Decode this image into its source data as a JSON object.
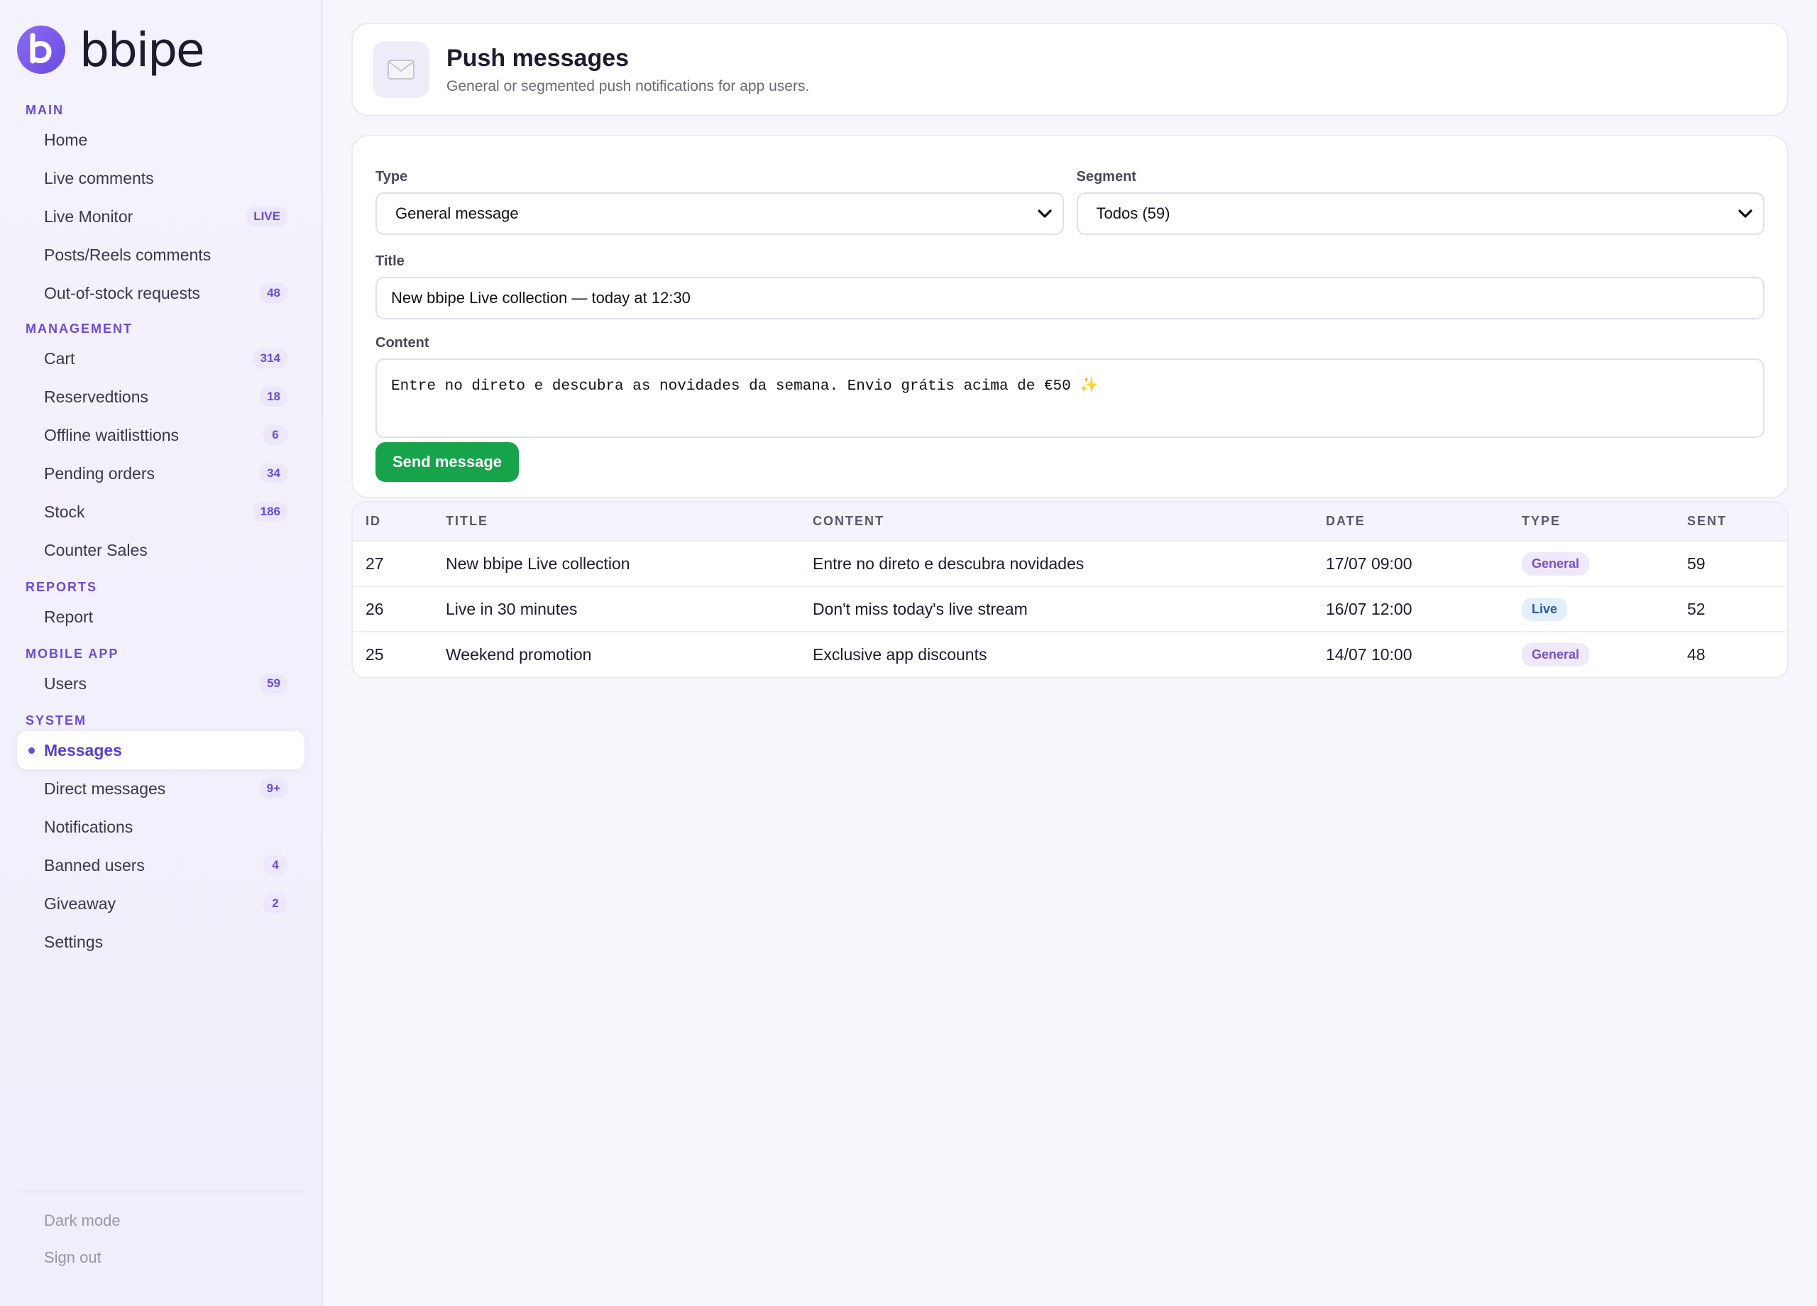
{
  "brand": {
    "name": "bbipe"
  },
  "sidebar": {
    "sections": {
      "main": "MAIN",
      "management": "MANAGEMENT",
      "reports": "REPORTS",
      "mobile": "MOBILE APP",
      "system": "SYSTEM"
    },
    "main": [
      {
        "label": "Home",
        "badge": ""
      },
      {
        "label": "Live comments",
        "badge": ""
      },
      {
        "label": "Live Monitor",
        "badge": "LIVE"
      },
      {
        "label": "Posts/Reels comments",
        "badge": ""
      },
      {
        "label": "Out-of-stock requests",
        "badge": "48"
      }
    ],
    "management": [
      {
        "label": "Cart",
        "badge": "314"
      },
      {
        "label": "Reservedtions",
        "badge": "18"
      },
      {
        "label": "Offline waitlisttions",
        "badge": "6"
      },
      {
        "label": "Pending orders",
        "badge": "34"
      },
      {
        "label": "Stock",
        "badge": "186"
      },
      {
        "label": "Counter Sales",
        "badge": ""
      }
    ],
    "reports": [
      {
        "label": "Report",
        "badge": ""
      }
    ],
    "mobile": [
      {
        "label": "Users",
        "badge": "59"
      }
    ],
    "system": [
      {
        "label": "Messages",
        "badge": ""
      },
      {
        "label": "Direct messages",
        "badge": "9+"
      },
      {
        "label": "Notifications",
        "badge": ""
      },
      {
        "label": "Banned users",
        "badge": "4"
      },
      {
        "label": "Giveaway",
        "badge": "2"
      },
      {
        "label": "Settings",
        "badge": ""
      }
    ],
    "footer": {
      "dark_mode": "Dark mode",
      "sign_out": "Sign out"
    }
  },
  "header": {
    "title": "Push messages",
    "subtitle": "General or segmented push notifications for app users."
  },
  "form": {
    "type_label": "Type",
    "type_value": "General message",
    "segment_label": "Segment",
    "segment_value": "Todos (59)",
    "title_label": "Title",
    "title_value": "New bbipe Live collection — today at 12:30",
    "content_label": "Content",
    "content_value": "Entre no direto e descubra as novidades da semana. Envio grátis acima de €50 ✨",
    "send_label": "Send message"
  },
  "table": {
    "headers": [
      "ID",
      "TITLE",
      "CONTENT",
      "DATE",
      "TYPE",
      "SENT"
    ],
    "rows": [
      {
        "id": "27",
        "title": "New bbipe Live collection",
        "content": "Entre no direto e descubra novidades",
        "date": "17/07 09:00",
        "type": "General",
        "sent": "59"
      },
      {
        "id": "26",
        "title": "Live in 30 minutes",
        "content": "Don't miss today's live stream",
        "date": "16/07 12:00",
        "type": "Live",
        "sent": "52"
      },
      {
        "id": "25",
        "title": "Weekend promotion",
        "content": "Exclusive app discounts",
        "date": "14/07 10:00",
        "type": "General",
        "sent": "48"
      }
    ]
  },
  "colors": {
    "accent": "#6a4cd6",
    "send_button": "#17a34a",
    "tag_general": "#7a4fc9",
    "tag_live": "#2c5ea8"
  },
  "icons": {
    "header": "envelope-icon",
    "select_arrow": "chevron-down-icon",
    "logo": "bbipe-logo-icon"
  }
}
